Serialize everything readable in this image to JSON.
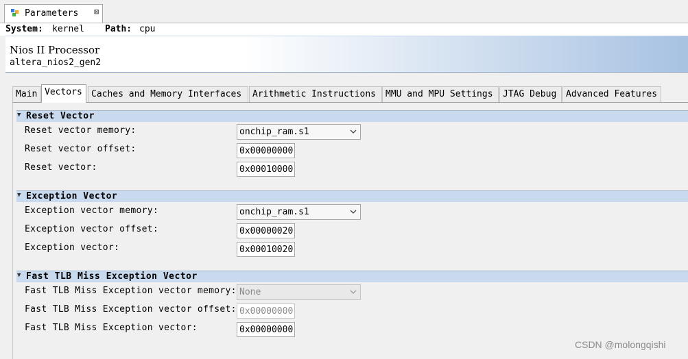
{
  "window_tab": {
    "title": "Parameters",
    "close": "⊠",
    "icon": "parameters-icon"
  },
  "pathbar": {
    "system_label": "System:",
    "system_value": "kernel",
    "path_label": "Path:",
    "path_value": "cpu"
  },
  "header": {
    "title": "Nios II Processor",
    "subtitle": "altera_nios2_gen2"
  },
  "tabs": [
    {
      "label": "Main"
    },
    {
      "label": "Vectors"
    },
    {
      "label": "Caches and Memory Interfaces"
    },
    {
      "label": "Arithmetic Instructions"
    },
    {
      "label": "MMU and MPU Settings"
    },
    {
      "label": "JTAG Debug"
    },
    {
      "label": "Advanced Features"
    }
  ],
  "active_tab": "Vectors",
  "reset": {
    "title": "Reset Vector",
    "memory_label": "Reset vector memory:",
    "memory_value": "onchip_ram.s1",
    "offset_label": "Reset vector offset:",
    "offset_value": "0x00000000",
    "vector_label": "Reset vector:",
    "vector_value": "0x00010000"
  },
  "exception": {
    "title": "Exception Vector",
    "memory_label": "Exception vector memory:",
    "memory_value": "onchip_ram.s1",
    "offset_label": "Exception vector offset:",
    "offset_value": "0x00000020",
    "vector_label": "Exception vector:",
    "vector_value": "0x00010020"
  },
  "tlb": {
    "title": "Fast TLB Miss Exception Vector",
    "memory_label": "Fast TLB Miss Exception vector memory:",
    "memory_value": "None",
    "offset_label": "Fast TLB Miss Exception vector offset:",
    "offset_value": "0x00000000",
    "vector_label": "Fast TLB Miss Exception vector:",
    "vector_value": "0x00000000"
  },
  "watermark": "CSDN @molongqishi",
  "colors": {
    "section_header": "#c9d9ee",
    "header_gradient_end": "#a7c2e2"
  }
}
